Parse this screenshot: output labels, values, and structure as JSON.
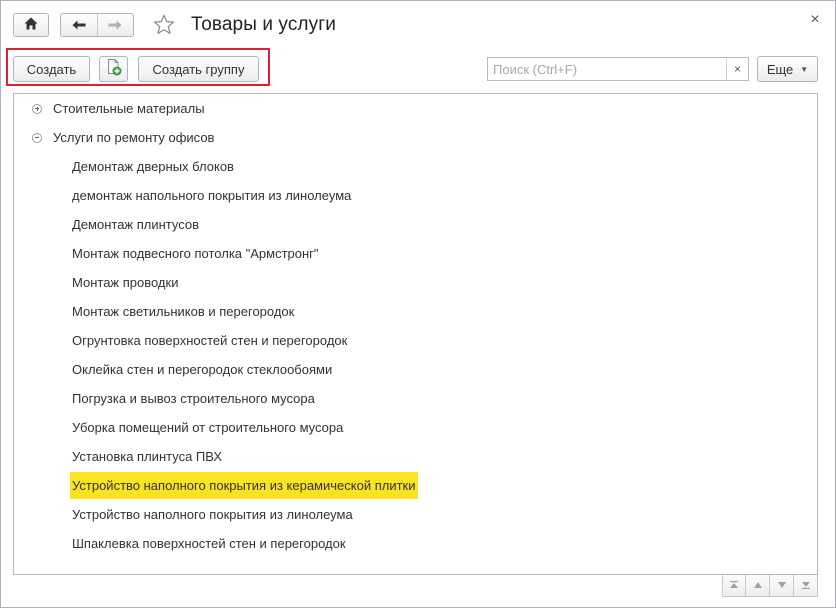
{
  "window": {
    "title": "Товары и услуги",
    "close_label": "×"
  },
  "titlebar": {
    "home_icon": "home-icon",
    "back_icon": "arrow-left-icon",
    "forward_icon": "arrow-right-icon",
    "favorite_icon": "star-outline-icon"
  },
  "toolbar": {
    "create_label": "Создать",
    "copy_icon": "create-copy-icon",
    "create_group_label": "Создать группу",
    "more_label": "Еще",
    "highlight_color": "#d9232e"
  },
  "search": {
    "placeholder": "Поиск (Ctrl+F)",
    "value": "",
    "clear_label": "×"
  },
  "tree": {
    "selection_color": "#fae321",
    "groups": [
      {
        "label": "Стоительные материалы",
        "expanded": false
      },
      {
        "label": "Услуги по ремонту офисов",
        "expanded": true
      }
    ],
    "items": [
      {
        "label": "Демонтаж дверных блоков"
      },
      {
        "label": "демонтаж напольного покрытия из линолеума"
      },
      {
        "label": "Демонтаж плинтусов"
      },
      {
        "label": "Монтаж подвесного потолка \"Армстронг\""
      },
      {
        "label": "Монтаж проводки"
      },
      {
        "label": "Монтаж светильников и перегородок"
      },
      {
        "label": "Огрунтовка поверхностей стен и перегородок"
      },
      {
        "label": "Оклейка стен и перегородок стеклообоями"
      },
      {
        "label": "Погрузка и вывоз строительного мусора"
      },
      {
        "label": "Уборка помещений от строительного мусора"
      },
      {
        "label": "Установка плинтуса ПВХ"
      },
      {
        "label": "Устройство наполного покрытия из керамической плитки",
        "selected": true
      },
      {
        "label": "Устройство наполного покрытия из линолеума"
      },
      {
        "label": "Шпаклевка поверхностей стен и перегородок"
      }
    ]
  },
  "scroll_buttons": {
    "icons": [
      "scroll-top-icon",
      "scroll-up-icon",
      "scroll-down-icon",
      "scroll-bottom-icon"
    ]
  }
}
